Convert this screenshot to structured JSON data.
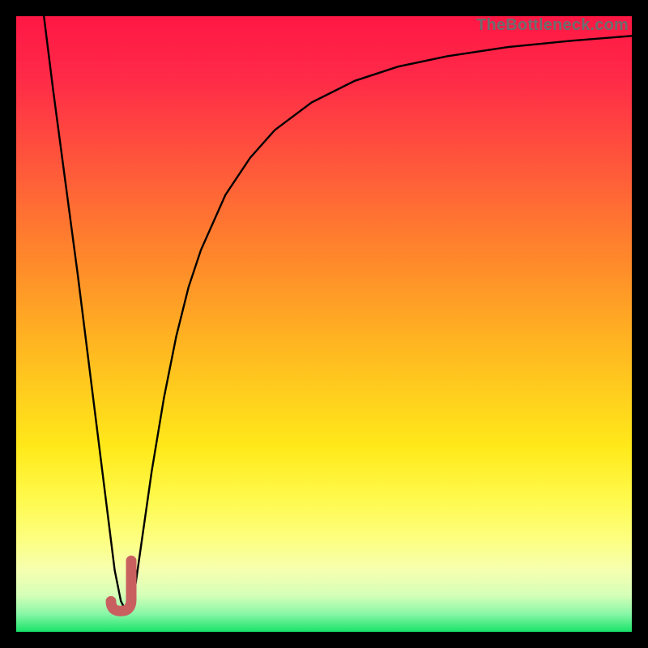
{
  "watermark": "TheBottleneck.com",
  "colors": {
    "gradient_stops": [
      {
        "offset": 0.0,
        "color": "#ff1744"
      },
      {
        "offset": 0.1,
        "color": "#ff2a48"
      },
      {
        "offset": 0.25,
        "color": "#ff5a3a"
      },
      {
        "offset": 0.4,
        "color": "#ff8a2a"
      },
      {
        "offset": 0.55,
        "color": "#ffbb20"
      },
      {
        "offset": 0.7,
        "color": "#ffe91a"
      },
      {
        "offset": 0.78,
        "color": "#fff94a"
      },
      {
        "offset": 0.85,
        "color": "#fdff80"
      },
      {
        "offset": 0.9,
        "color": "#f6ffb0"
      },
      {
        "offset": 0.94,
        "color": "#d6ffb8"
      },
      {
        "offset": 0.97,
        "color": "#8cf7a8"
      },
      {
        "offset": 1.0,
        "color": "#19e36a"
      }
    ],
    "curve": "#000000",
    "marker": "#c96060"
  },
  "chart_data": {
    "type": "line",
    "title": "",
    "xlabel": "",
    "ylabel": "",
    "xlim": [
      0,
      100
    ],
    "ylim": [
      0,
      100
    ],
    "series": [
      {
        "name": "bottleneck-curve",
        "x": [
          4.5,
          6,
          8,
          10,
          12,
          13.5,
          15,
          16,
          17,
          18,
          19,
          20,
          22,
          24,
          26,
          28,
          30,
          34,
          38,
          42,
          48,
          55,
          62,
          70,
          80,
          90,
          100
        ],
        "y": [
          100,
          88,
          73,
          58,
          42,
          30,
          18,
          10,
          5,
          3,
          5,
          12,
          26,
          38,
          48,
          56,
          62,
          71,
          77,
          81.5,
          86,
          89.5,
          91.8,
          93.5,
          95,
          96,
          96.8
        ]
      }
    ],
    "marker": {
      "name": "optimal-point-J",
      "shape": "J",
      "x": 17.5,
      "y": 6,
      "color": "#c96060"
    }
  }
}
